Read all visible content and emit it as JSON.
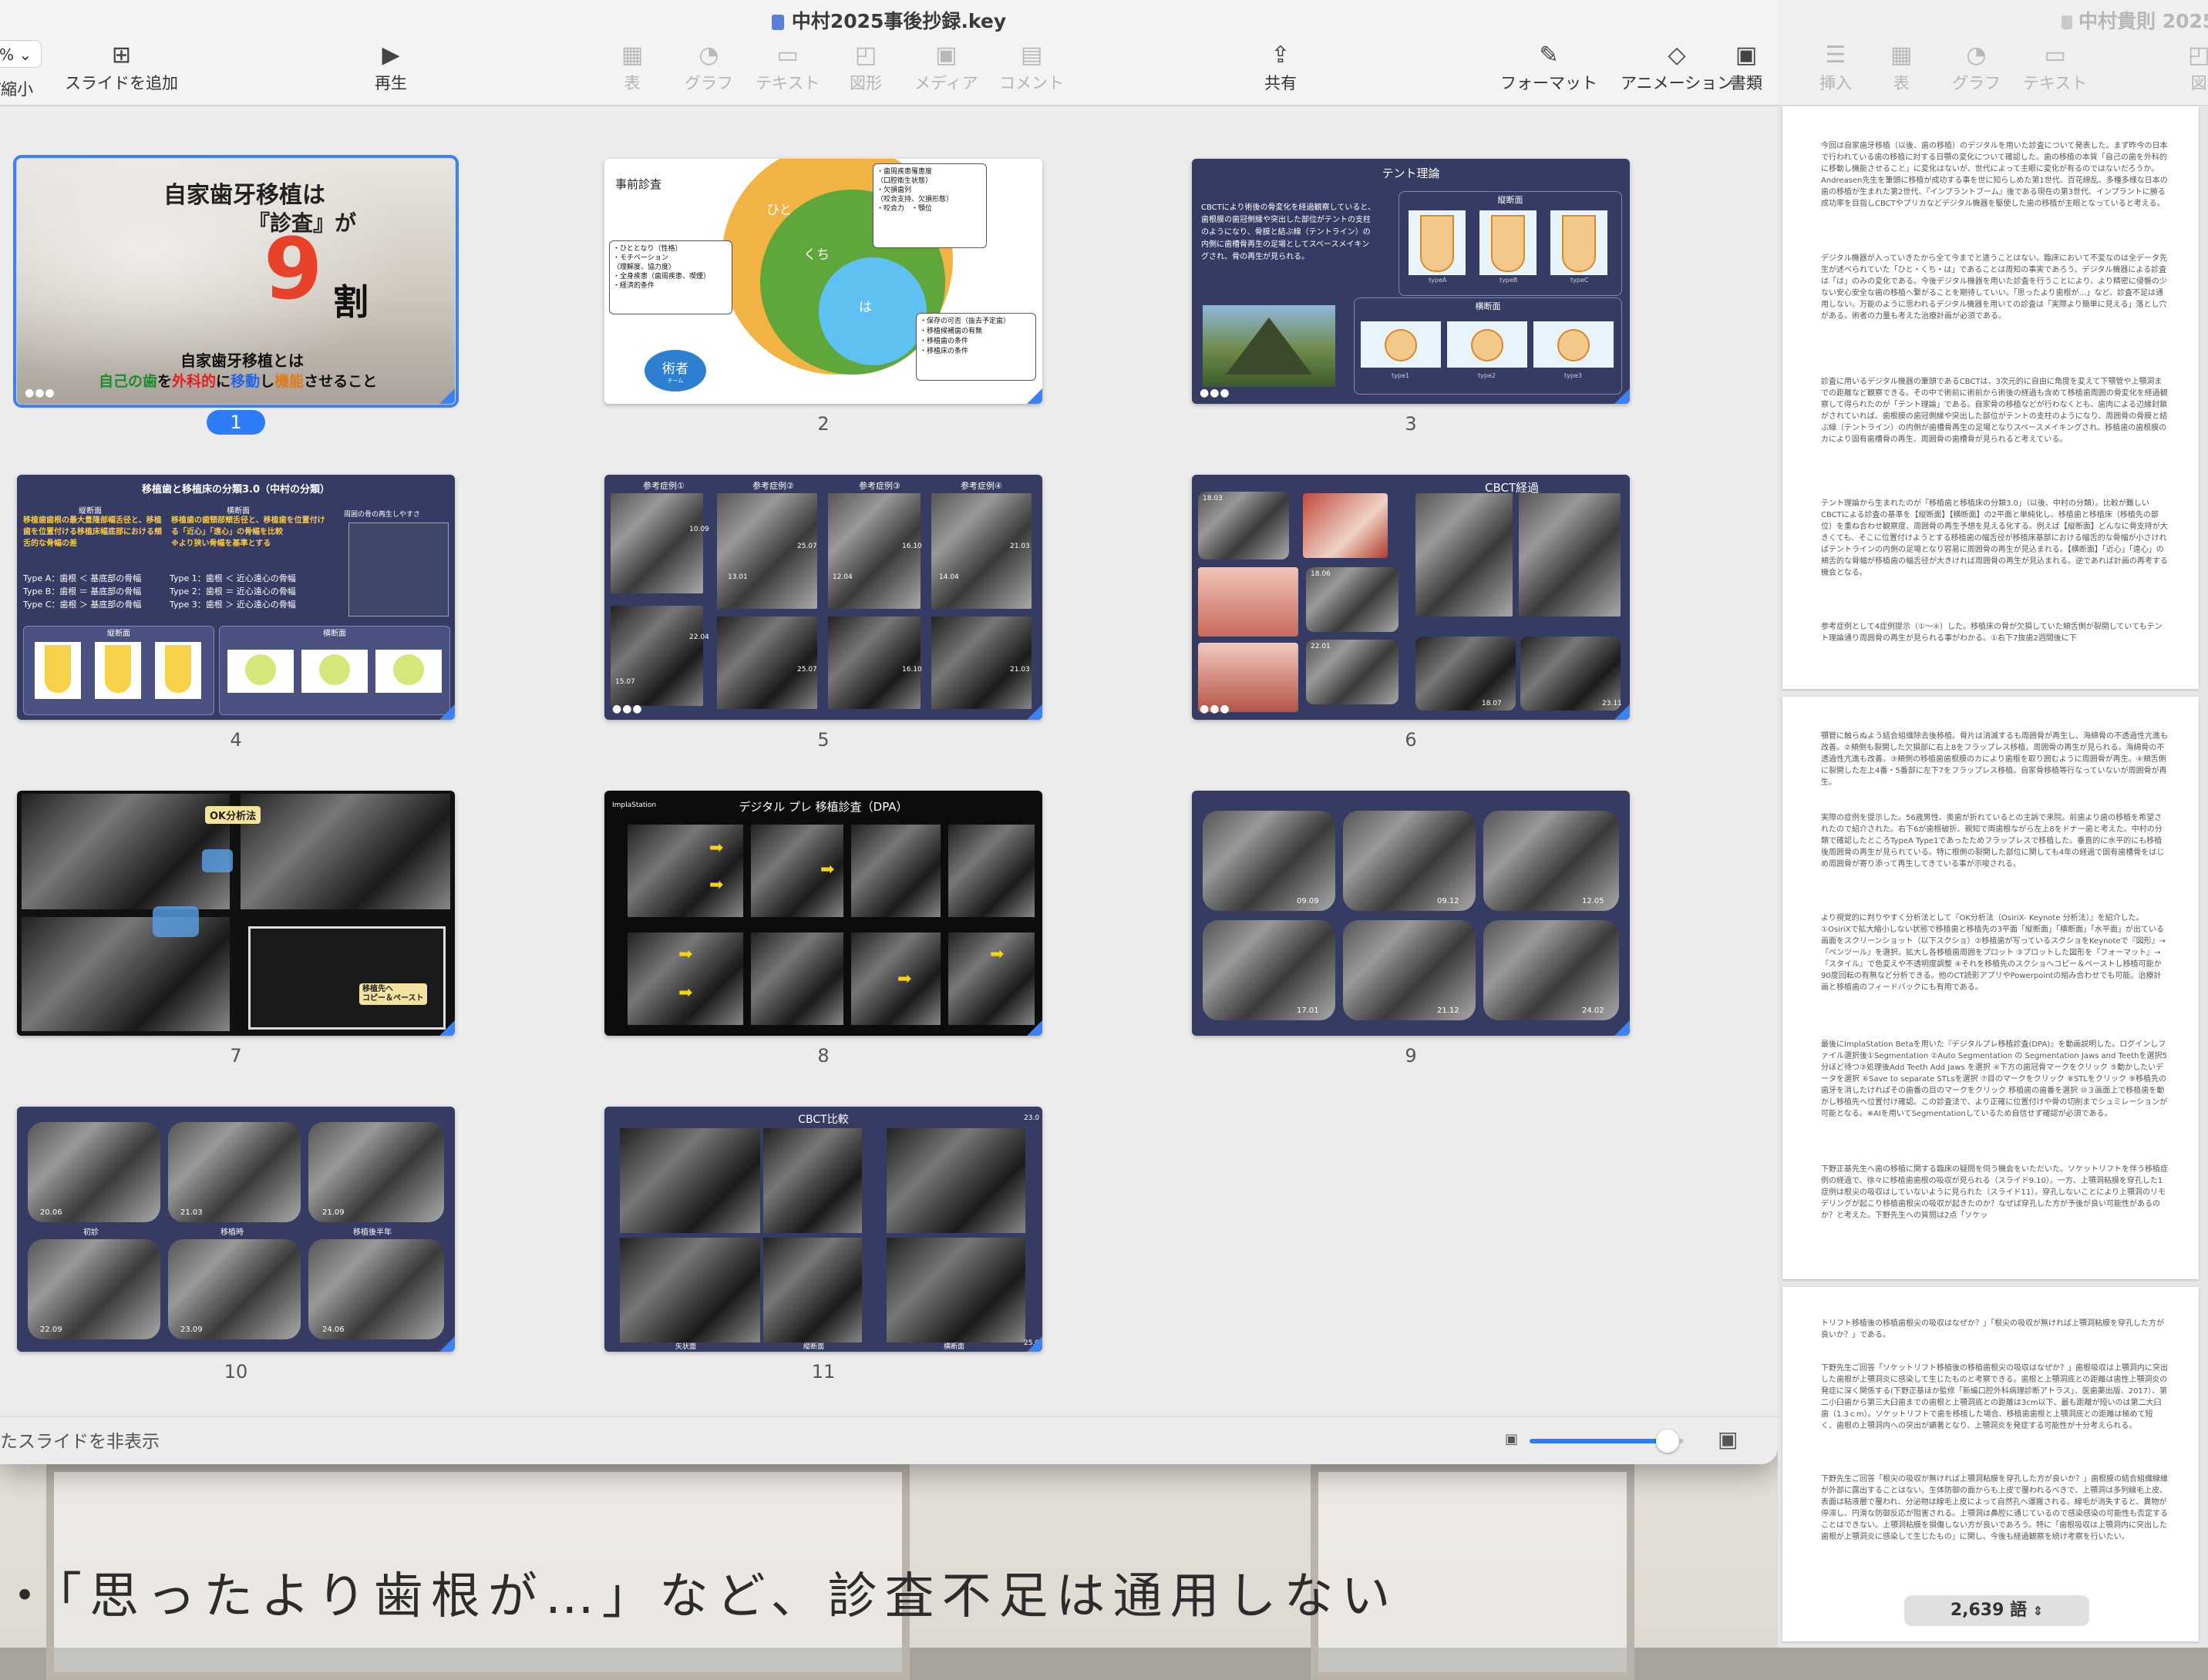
{
  "background": {
    "caption": "・「思ったより歯根が…」など、診査不足は通用しない"
  },
  "keynote": {
    "title": "中村2025事後抄録.key",
    "zoom_value": "%",
    "zoom_label": "/縮小",
    "toolbar": {
      "add_slide": "スライドを追加",
      "play": "再生",
      "table": "表",
      "chart": "グラフ",
      "text": "テキスト",
      "shape": "図形",
      "media": "メディア",
      "comment": "コメント",
      "share": "共有",
      "format": "フォーマット",
      "animate": "アニメーション",
      "document": "書類"
    },
    "hide_skipped": "たスライドを非表示",
    "slides": [
      {
        "number": "1",
        "title_line1": "自家歯牙移植は",
        "title_line2": "『診査』が",
        "big_number": "9",
        "big_suffix": "割",
        "subtitle": "自家歯牙移植とは",
        "tag_a": "自己の歯",
        "tag_b": "を",
        "tag_c": "外科的",
        "tag_d": "に",
        "tag_e": "移動",
        "tag_f": "し",
        "tag_g": "機能",
        "tag_h": "させること"
      },
      {
        "number": "2",
        "title": "事前診査",
        "hito": "ひと",
        "kuchi": "くち",
        "ha": "は",
        "box1": "・歯周疾患罹患度\n（口腔衛生状態）\n・欠損歯列\n（咬合支持、欠損形態）\n・咬合力　・顎位",
        "box2": "・ひととなり（性格）\n・モチベーション\n（理解度、協力度）\n・全身疾患（歯周疾患、喫煙）\n・経済的条件",
        "box3": "・保存の可否（抜去予定歯）\n・移植候補歯の有無\n・移植歯の条件\n・移植床の条件",
        "jutsusha": "術者",
        "team": "チーム"
      },
      {
        "number": "3",
        "title": "テント理論",
        "body": "CBCTにより術後の骨変化を経過観察していると、歯根膜の歯冠側縁や突出した部位がテントの支柱のようになり、骨膜と結ぶ線（テントライン）の内側に歯槽骨再生の足場としてスペースメイキングされ、骨の再生が見られる。",
        "longitudinal": "縦断面",
        "transverse": "横断面",
        "types_upper": [
          "typeA",
          "typeB",
          "typeC"
        ],
        "types_lower": [
          "type1",
          "type2",
          "type3"
        ]
      },
      {
        "number": "4",
        "title": "移植歯と移植床の分類3.0（中村の分類）",
        "col1": "縦断面",
        "col2": "横断面",
        "col3": "周囲の骨の再生しやすさ",
        "text1": "移植歯歯根の最大豊隆部幅舌径と、移植歯を位置付ける移植床幅底部における頬舌的な骨幅の差",
        "text2": "移植歯の歯頸部頬舌径と、移植歯を位置付ける「近心」「遠心」の骨幅を比較\n※より狭い骨幅を基準とする",
        "typeA": "Type A：歯根 ＜ 基底部の骨幅",
        "typeB": "Type B：歯根 ＝ 基底部の骨幅",
        "typeC": "Type C：歯根 ＞ 基底部の骨幅",
        "type1": "Type 1：歯根 ＜ 近心遠心の骨幅",
        "type2": "Type 2：歯根 ＝ 近心遠心の骨幅",
        "type3": "Type 3：歯根 ＞ 近心遠心の骨幅",
        "lower_left": "縦断面",
        "lower_right": "横断面"
      },
      {
        "number": "5",
        "cases": [
          "参考症例①",
          "参考症例②",
          "参考症例③",
          "参考症例④"
        ],
        "dates": [
          "10.09",
          "25.07",
          "16.10",
          "21.03",
          "13.01",
          "12.04",
          "14.04",
          "22.04",
          "15.07",
          "25.07",
          "16.10",
          "21.03"
        ]
      },
      {
        "number": "6",
        "title": "CBCT経過",
        "dates": [
          "18.03",
          "18.06",
          "22.01",
          "18.07",
          "23.11"
        ]
      },
      {
        "number": "7",
        "label": "OK分析法",
        "note": "移植先へ\nコピー＆ペースト"
      },
      {
        "number": "8",
        "title": "デジタル プレ 移植診査（DPA）",
        "brand": "ImplaStation"
      },
      {
        "number": "9",
        "dates": [
          "09.09",
          "09.12",
          "12.05",
          "17.01",
          "21.12",
          "24.02"
        ]
      },
      {
        "number": "10",
        "dates": [
          "20.06",
          "21.03",
          "21.09",
          "22.09",
          "23.09",
          "24.06"
        ],
        "captions": [
          "初診",
          "移植時",
          "移植後半年"
        ]
      },
      {
        "number": "11",
        "title": "CBCT比較",
        "captions": [
          "矢状面",
          "縦断面",
          "横断面"
        ],
        "dates": [
          "23.0",
          "25.0"
        ]
      }
    ]
  },
  "pages": {
    "title": "中村貴則 2025",
    "toolbar": {
      "insert": "挿入",
      "table": "表",
      "chart": "グラフ",
      "text": "テキスト",
      "shape": "図"
    },
    "word_count": "2,639 語",
    "paragraphs": [
      "今回は自家歯牙移植（以後、歯の移植）のデジタルを用いた診査について発表した。まず昨今の日本で行われている歯の移植に対する日顎の変化について確認した。歯の移植の本質「自己の歯を外科的に移動し機能させること」に変化はないが、世代によって主眼に変化が有るのではないだろうか。Andreasen先生を筆頭に移植が成功する事を世に知らしめた第1世代、百花繚乱、多種多様な日本の歯の移植が生まれた第2世代、『インプラントブーム』後である現在の第3世代、インプラントに勝る成功率を目指しCBCTやプリカなどデジタル機器を駆使した歯の移植が主眼となっていると考える。",
      "デジタル機器が入っていきたから全て今までと違うことはない。臨床において不変なのは全データ先生が述べられていた「ひと・くち・は」であることは周知の事実であろう。デジタル機器による診査は「は」のみの変化である。今後デジタル機器を用いた診査を行うことにより、より精密に侵襲の少ない安心安全な歯の移植へ繋がることを期待していい。「思ったより歯根が…」など、診査不足は通用しない。万能のように思われるデジタル機器を用いての診査は「実際より簡単に見える」落とし穴がある。術者の力量も考えた治療計画が必須である。",
      "診査に用いるデジタル機器の筆頭であるCBCTは、3次元的に自由に角度を変えて下顎管や上顎洞までの距離など観察できる。その中で術前に術前から術後の経過も含めて移植歯周囲の骨変化を経過観察して得られたのが「テント理論」である。自家骨の移植などが行わなくとも、歯肉による辺縁封鎖がされていれば、歯根膜の歯冠側縁や突出した部位がテントの支柱のようになり、周囲骨の骨膜と結ぶ線（テントライン）の内側が歯槽骨再生の足場となりスペースメイキングされ、移植歯の歯根膜のカにより固有歯槽骨の再生、周囲骨の歯槽骨が見られると考えている。",
      "テント理論から生まれたのが「移植歯と移植床の分類3.0」（以後、中村の分類）。比較が難しいCBCTによる診査の基準を【縦断面】【横断面】の2平面と単純化し、移植歯と移植床（移植先の部位）を重ね合わせ観察度、周囲骨の再生予想を見える化する。例えば【縦断面】どんなに骨支持が大きくても、そこに位置付けようとする移植歯の幅舌径が移植床基部における幅舌的な骨幅が小さければテントラインの内側の足場となり容易に周囲骨の再生が見込まれる。【横断面】「近心」「遠心」の頬舌的な骨幅が移植歯の幅舌径が大きければ周囲骨の再生が見込まれる。逆であれば計画の再考する機会となる。",
      "参考症例として4症例提示（①〜④）した。移植床の骨が欠損していた頬舌側が裂開していてもテント理論通り周囲骨の再生が見られる事がわかる。①右下7抜歯2週間後に下",
      "顎管に触らぬよう結合組織除去後移植。骨片は消滅するも周囲骨が再生し、海綿骨の不透過性亢進も改善。②頬側も裂開した欠損部に右上8をフラップレス移植。周囲骨の再生が見られる。海綿骨の不透過性亢進も改善。③頬側の移植歯歯根膜のカにより歯根を取り囲むように周囲骨が再生。④頬舌側に裂開した左上4番・5番部に左下7をフラップレス移植。自家骨移植等行なっていないが周囲骨が再生。",
      "実際の症例を提示した。56歳男性、奥歯が折れているとの主訴で来院。前歯より歯の移植を希望されたので紹介された。右下6が歯根破折、親知で両歯根ながら左上8をドナー歯と考えた。中村の分類で確認したところTypeA Type1であったためフラップレスで移植した。垂直的に水平的にも移植後周囲骨の再生が見られている。特に根側の裂開した部位に関しても4年の経過で固有歯槽骨をはじめ周囲骨が寄り添って再生してきている事が示唆される。",
      "より視覚的に判りやすく分析法として『OK分析法（OsiriX- Keynote 分析法）』を紹介した。①OsiriXで拡大縮小しない状態で移植歯と移植先の3平面「縦断面」「横断面」「水平面」が出ている画面をスクリーンショット（以下スクショ）②移植歯が写っているスクショをKeynoteで『図形』→『ペンツール』を選択、拡大し各移植歯周囲をプロット ③プロットした図形を『フォーマット』→『スタイル』で色変えや不透明度調整 ④それを移植先のスクショへコピー＆ペーストし移植可能か90度回転の有無など分析できる。他のCT読影アプリやPowerpointの組み合わせでも可能。治療計画と移植歯のフィードバックにも有用である。",
      "最後にImplaStation Betaを用いた『デジタルプレ移植診査(DPA)』を動画説明した。ログインしファイル選択後①Segmentation ②Auto Segmentation の Segmentation Jaws and Teethを選択5分ほど待つ③処理後Add Teeth Add Jaws を選択 ④下方の歯冠骨マークをクリック ⑤動かしたいデータを選択 ⑥Save to separate STLsを選択 ⑦目のマークをクリック ⑧STLをクリック ⑨移植先の歯牙を消したければその歯番の目のマークをクリック 移植歯の歯番を選択 ⑩３画面上で移植歯を動かし移植先へ位置付け確認。この診査法で、より正確に位置付けや骨の切削までシュミレーションが可能となる。※AIを用いてSegmentationしているため自信せず確認が必須である。",
      "下野正基先生へ歯の移植に関する臨床の疑問を伺う機会をいただいた。ソケットリフトを伴う移植症例の経過で、徐々に移植歯歯根の吸収が見られる（スライド9.10）。一方、上顎洞粘膜を穿孔した1症例は根尖の吸収はしていないように見られた（スライド11）。穿孔しないことにより上顎洞のリモデリングが起こり移植歯根尖の吸収が起きたのか？なぜば穿孔した方が予後が良い可能性があるのか？と考えた。下野先生への質問は2点「ソケッ",
      "トリフト移植後の移植歯根尖の吸収はなぜか？」「根尖の吸収が無ければ上顎洞粘膜を穿孔した方が良いか？」である。",
      "下野先生ご回答「ソケットリフト移植後の移植歯根尖の吸収はなぜか？」歯根吸収は上顎洞内に突出した歯根が上顎洞炎に感染して生じたものと考察できる。歯根と上顎洞底との距離は歯性上顎洞炎の発症に深く関係する(下野正基ほか監修「新編口腔外科病理診断アトラス」、医歯薬出版、2017）、第二小臼歯から第三大臼歯までの歯根と上顎洞底との距離は3cm以下、最も距離が短いのは第二大臼歯（1.3ｃm）。ソケットリフトで歯を移植した場合、移植歯歯根と上顎洞底との距離は極めて短く、歯根の上顎洞内への突出が顕著となり、上顎洞炎を発症する可能性が十分考えられる。",
      "下野先生ご回答「根尖の吸収が無ければ上顎洞粘膜を穿孔した方が良いか？」歯根膜の結合組織線維が外部に露出することはない。生体防御の面からも上皮で覆われるべきで、上顎洞は多列線毛上皮、表面は粘液層で覆われ、分泌物は線毛上皮によって自然孔へ運搬される。線毛が消失すると、異物が停滞し、円滑な防御反応が阻害される。上顎洞は鼻腔に通じているので感染感染の可能性も否定することはできない。上顎洞粘膜を損傷しない方が良いであろう。特に「歯根吸収は上顎洞内に突出した歯根が上顎洞炎に感染して生じたもの」に関し、今後も経過観察を続け考察を行いたい。"
    ]
  }
}
